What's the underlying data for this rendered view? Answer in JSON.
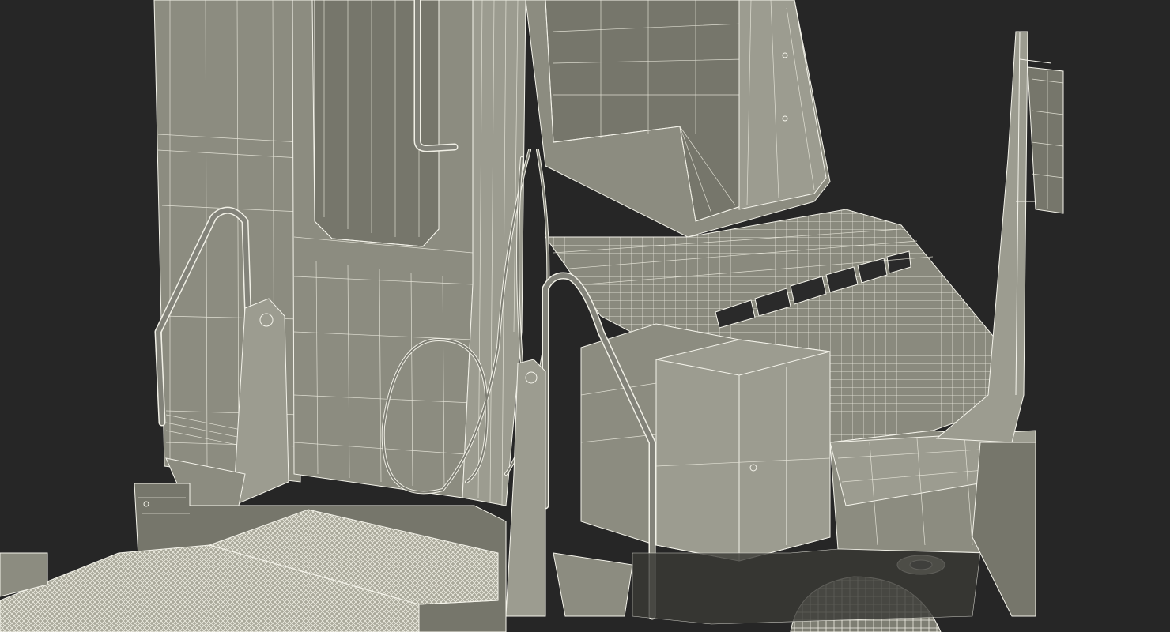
{
  "scene": {
    "subject": "semi-truck-cab-wireframe",
    "colors": {
      "background": "#262626",
      "surface": "#8c8c80",
      "surface_dark": "#76766b",
      "surface_light": "#9c9c90",
      "wire": "#f4f3ea",
      "deck": "#b8b7a8"
    }
  }
}
